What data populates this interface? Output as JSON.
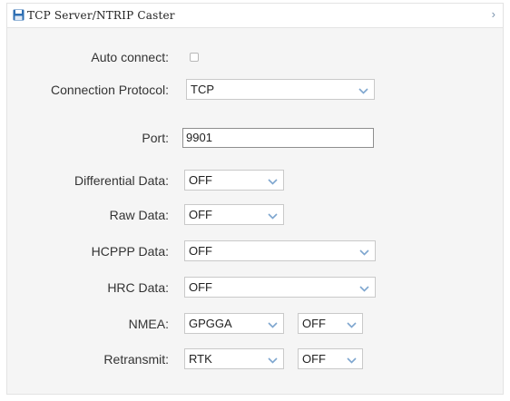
{
  "title": "TCP Server/NTRIP Caster",
  "icons": {
    "title": "save-disk-icon",
    "toggle": "chevron-right-icon"
  },
  "toggle_glyph": "›",
  "colors": {
    "title_icon": "#2f6fb3",
    "chevron": "#7ea6cf",
    "panel_bg": "#f5f5f5"
  },
  "form": {
    "auto_connect": {
      "label": "Auto connect:",
      "checked": false
    },
    "connection_protocol": {
      "label": "Connection Protocol:",
      "value": "TCP"
    },
    "port": {
      "label": "Port:",
      "value": "9901"
    },
    "differential_data": {
      "label": "Differential Data:",
      "value": "OFF"
    },
    "raw_data": {
      "label": "Raw Data:",
      "value": "OFF"
    },
    "hcppp_data": {
      "label": "HCPPP Data:",
      "value": "OFF"
    },
    "hrc_data": {
      "label": "HRC Data:",
      "value": "OFF"
    },
    "nmea": {
      "label": "NMEA:",
      "type_value": "GPGGA",
      "rate_value": "OFF"
    },
    "retransmit": {
      "label": "Retransmit:",
      "type_value": "RTK",
      "rate_value": "OFF"
    }
  }
}
